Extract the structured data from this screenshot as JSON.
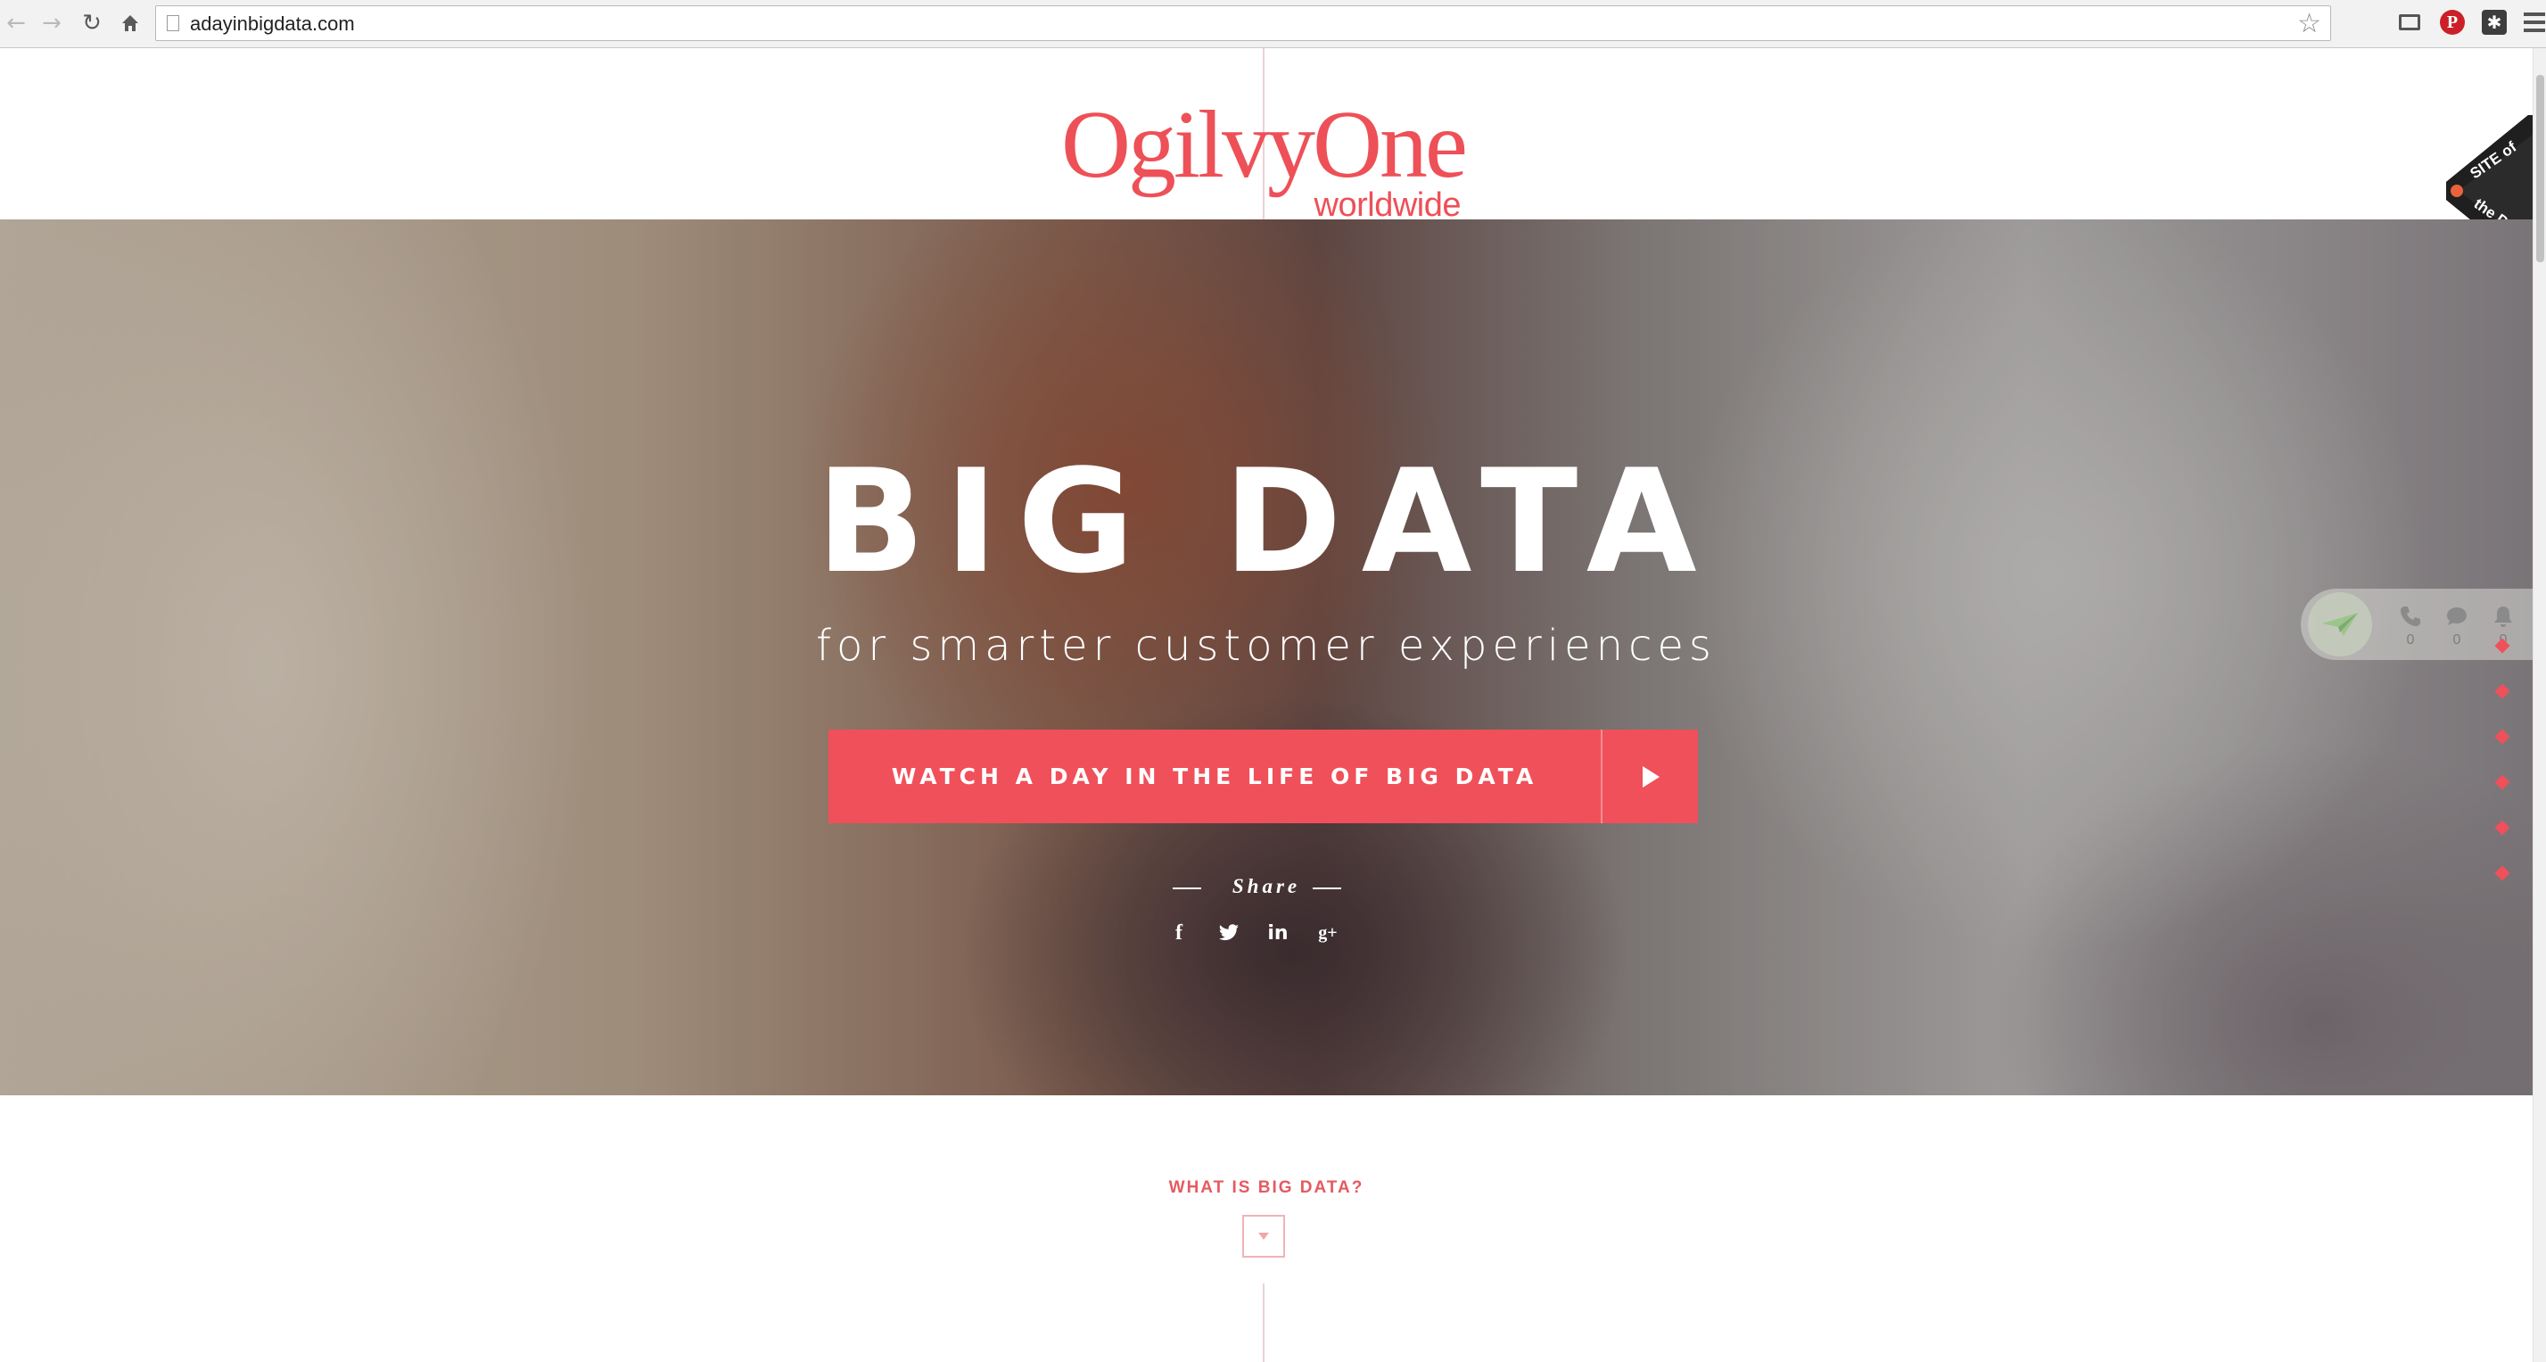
{
  "browser": {
    "url": "adayinbigdata.com"
  },
  "header": {
    "logo_main": "OgilvyOne",
    "logo_sub": "worldwide",
    "ribbon_line1": "SITE of",
    "ribbon_line2": "the DAY"
  },
  "hero": {
    "title": "BIG DATA",
    "subtitle": "for smarter customer experiences",
    "cta_label": "WATCH A DAY IN THE LIFE OF BIG DATA",
    "share_label": "Share",
    "social": [
      "facebook-icon",
      "twitter-icon",
      "linkedin-icon",
      "google-plus-icon"
    ]
  },
  "widget": {
    "calls_count": "0",
    "messages_count": "0",
    "notifications_count": "0"
  },
  "section": {
    "what_label": "WHAT IS BIG DATA?"
  },
  "colors": {
    "accent": "#f0505a",
    "logo": "#ee5058"
  }
}
